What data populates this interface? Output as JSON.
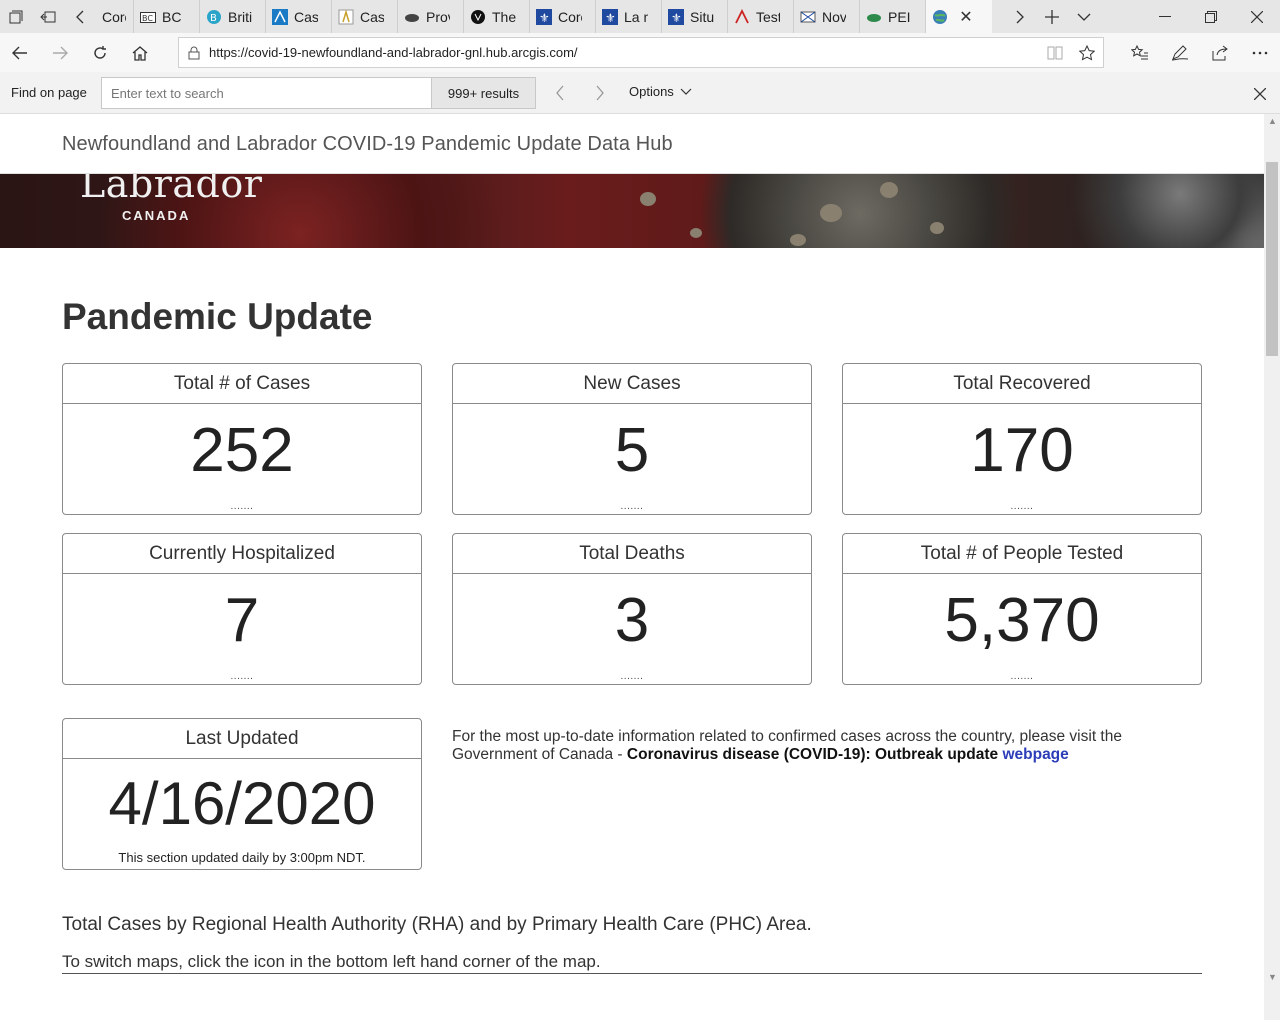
{
  "browser": {
    "tabs": [
      {
        "label": "Coro",
        "icon": "page-icon"
      },
      {
        "label": "BC C",
        "icon": "bc-icon"
      },
      {
        "label": "Briti",
        "icon": "globe-icon"
      },
      {
        "label": "Case",
        "icon": "alberta-icon"
      },
      {
        "label": "Case",
        "icon": "sask-icon"
      },
      {
        "label": "Prov",
        "icon": "bison-icon"
      },
      {
        "label": "The",
        "icon": "ontario-icon"
      },
      {
        "label": "Coro",
        "icon": "quebec-icon"
      },
      {
        "label": "La m",
        "icon": "quebec-icon"
      },
      {
        "label": "Situ",
        "icon": "quebec-icon"
      },
      {
        "label": "Test",
        "icon": "nb-icon"
      },
      {
        "label": "Nov",
        "icon": "ns-icon"
      },
      {
        "label": "PEI (",
        "icon": "pei-icon"
      }
    ],
    "url": "https://covid-19-newfoundland-and-labrador-gnl.hub.arcgis.com/",
    "find": {
      "label": "Find on page",
      "placeholder": "Enter text to search",
      "count": "999+ results",
      "options": "Options"
    }
  },
  "page": {
    "site_title": "Newfoundland and Labrador COVID-19 Pandemic Update Data Hub",
    "banner_word": "Labrador",
    "banner_sub": "CANADA",
    "heading": "Pandemic Update",
    "cards": [
      {
        "title": "Total # of Cases",
        "value": "252",
        "dots": "......."
      },
      {
        "title": "New Cases",
        "value": "5",
        "dots": "......."
      },
      {
        "title": "Total Recovered",
        "value": "170",
        "dots": "......."
      },
      {
        "title": "Currently Hospitalized",
        "value": "7",
        "dots": "......."
      },
      {
        "title": "Total Deaths",
        "value": "3",
        "dots": "......."
      },
      {
        "title": "Total # of People Tested",
        "value": "5,370",
        "dots": "......."
      }
    ],
    "last_updated": {
      "title": "Last Updated",
      "value": "4/16/2020",
      "note": "This section updated daily by 3:00pm NDT."
    },
    "info": {
      "prefix": "For the most up-to-date information related to confirmed cases across the country, please visit the Government of Canada - ",
      "bold": "Coronavirus disease (COVID-19): Outbreak update",
      "link": "webpage"
    },
    "rha_heading": "Total Cases by Regional Health Authority (RHA) and by Primary Health Care (PHC) Area.",
    "switch_note": "To switch maps, click the icon in the bottom left hand corner of the map."
  },
  "colors": {
    "link": "#2b3db8",
    "card_border": "#8a8a8a",
    "text": "#333333"
  }
}
